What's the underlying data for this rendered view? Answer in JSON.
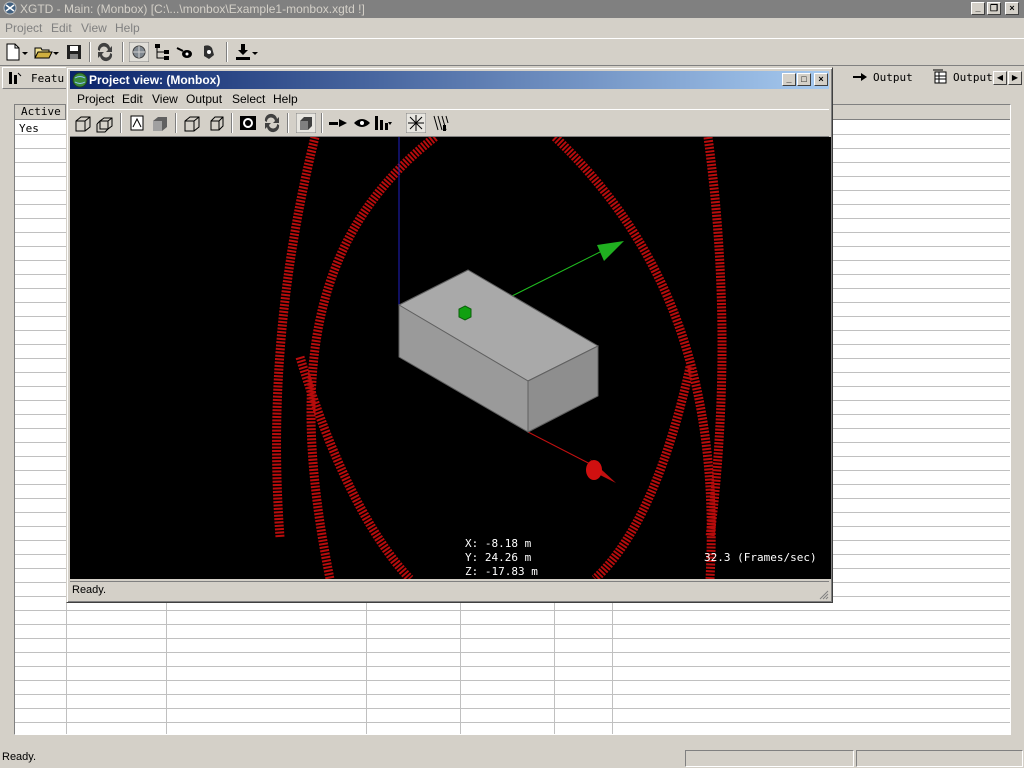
{
  "main_window": {
    "title": "XGTD - Main: (Monbox) [C:\\...\\monbox\\Example1-monbox.xgtd !]",
    "menu": [
      "Project",
      "Edit",
      "View",
      "Help"
    ]
  },
  "tabs": {
    "left_label": "Featur",
    "right": [
      "Output",
      "Output"
    ]
  },
  "grid": {
    "columns": [
      "Active"
    ],
    "rows": [
      [
        "Yes"
      ]
    ]
  },
  "status_bar": {
    "text": "Ready."
  },
  "project_window": {
    "title": "Project view: (Monbox)",
    "menu": [
      "Project",
      "Edit",
      "View",
      "Output",
      "Select",
      "Help"
    ],
    "status": "Ready.",
    "coords": {
      "x": "X: -8.18 m",
      "y": "Y: 24.26 m",
      "z": "Z: -17.83 m"
    },
    "fps": "32.3 (Frames/sec)"
  },
  "colors": {
    "title_active_start": "#0a246a",
    "title_active_end": "#a6caf0",
    "title_inactive": "#808080",
    "face": "#d4d0c8",
    "viewport_bg": "#000000",
    "orbit_red": "#cc1010",
    "axis_green": "#20c020",
    "axis_blue": "#2020c0",
    "box_gray": "#a8a8a8"
  },
  "icons": {
    "toolbar_main": [
      "new-icon",
      "open-icon",
      "save-icon",
      "transfer-icon",
      "globe-icon",
      "tree-icon",
      "eye-icon",
      "settings-icon",
      "download-icon"
    ],
    "toolbar_project": [
      "open-box-icon",
      "copy-box-icon",
      "plane-icon",
      "solid-icon",
      "wire-box-icon",
      "box-outline-icon",
      "camera-icon",
      "rotate-icon",
      "shade-icon",
      "arrow-icon",
      "eye-view-icon",
      "chart-icon",
      "burst-icon",
      "rays-icon"
    ]
  }
}
